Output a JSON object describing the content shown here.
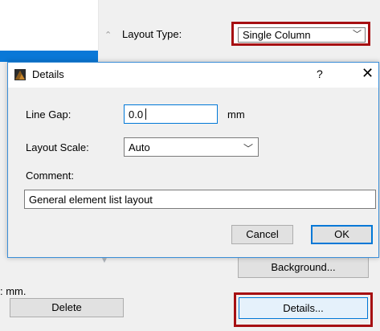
{
  "panel": {
    "layout_type_label": "Layout Type:",
    "layout_type_value": "Single Column",
    "background_button": "Background...",
    "mm_label": ": mm.",
    "delete_button": "Delete",
    "details_button": "Details..."
  },
  "dialog": {
    "title": "Details",
    "help": "?",
    "close": "✕",
    "line_gap_label": "Line Gap:",
    "line_gap_value": "0.0",
    "line_gap_unit": "mm",
    "layout_scale_label": "Layout Scale:",
    "layout_scale_value": "Auto",
    "comment_label": "Comment:",
    "comment_value": "General element list layout",
    "cancel_button": "Cancel",
    "ok_button": "OK"
  },
  "colors": {
    "highlight": "#a60f12",
    "accent": "#0078d7",
    "selection": "#0a78d7"
  }
}
